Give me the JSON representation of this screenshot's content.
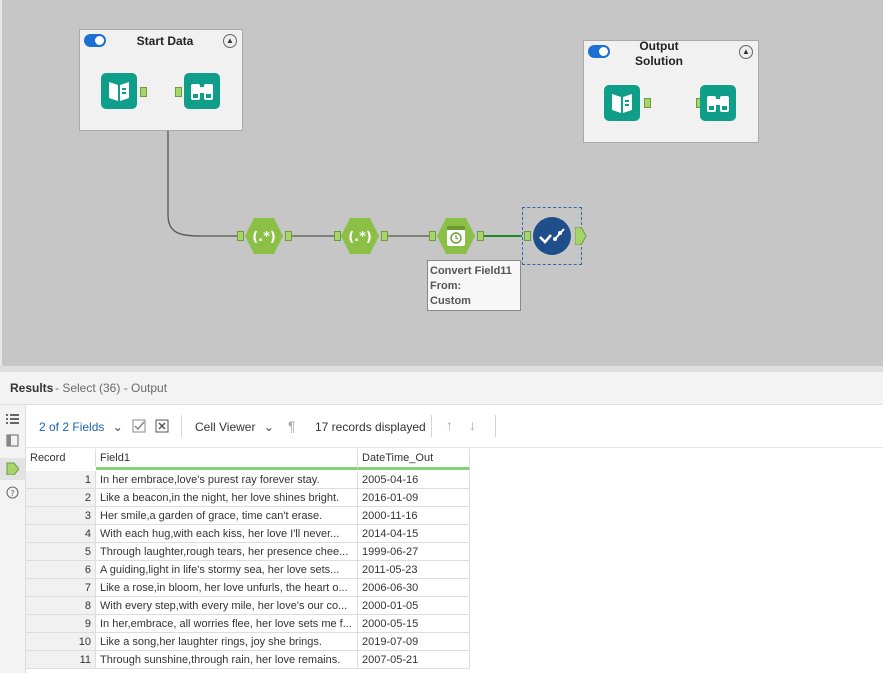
{
  "canvas": {
    "containers": [
      {
        "id": "start-data",
        "title": "Start Data"
      },
      {
        "id": "output-solution",
        "title_line1": "Output",
        "title_line2": "Solution"
      }
    ],
    "tooltip": {
      "line1": "Convert Field11",
      "line2": "From:",
      "line3": "Custom"
    },
    "tools": [
      "input-data-icon",
      "browse-icon",
      "regex-icon",
      "regex-icon",
      "datetime-icon",
      "select-icon"
    ],
    "colors": {
      "tool_teal": "#0f9e8a",
      "tool_green": "#8cbf45",
      "select_blue": "#1f4f8a",
      "wire": "#555555",
      "toggle_blue": "#1e6fd3"
    }
  },
  "results": {
    "title": "Results",
    "subtitle": "- Select (36) - Output"
  },
  "toolbar": {
    "fields_label": "2 of 2 Fields",
    "viewer_label": "Cell Viewer",
    "records_label": "17 records displayed"
  },
  "grid": {
    "columns": [
      "Record",
      "Field1",
      "DateTime_Out"
    ],
    "rows": [
      {
        "record": "1",
        "field1": "In her embrace,love's purest ray forever stay.",
        "date": "2005-04-16"
      },
      {
        "record": "2",
        "field1": "Like a beacon,in the night, her love shines bright.",
        "date": "2016-01-09"
      },
      {
        "record": "3",
        "field1": "Her smile,a garden of grace, time can't erase.",
        "date": "2000-11-16"
      },
      {
        "record": "4",
        "field1": "With each hug,with each kiss, her love I'll never...",
        "date": "2014-04-15"
      },
      {
        "record": "5",
        "field1": "Through laughter,rough tears, her presence chee...",
        "date": "1999-06-27"
      },
      {
        "record": "6",
        "field1": "A guiding,light in life's stormy sea, her love sets...",
        "date": "2011-05-23"
      },
      {
        "record": "7",
        "field1": "Like a rose,in bloom, her love unfurls, the heart o...",
        "date": "2006-06-30"
      },
      {
        "record": "8",
        "field1": "With every step,with every mile, her love's our co...",
        "date": "2000-01-05"
      },
      {
        "record": "9",
        "field1": "In her,embrace, all worries flee, her love sets me f...",
        "date": "2000-05-15"
      },
      {
        "record": "10",
        "field1": "Like a song,her laughter rings, joy she brings.",
        "date": "2019-07-09"
      },
      {
        "record": "11",
        "field1": "Through sunshine,through rain, her love remains.",
        "date": "2007-05-21"
      }
    ]
  }
}
